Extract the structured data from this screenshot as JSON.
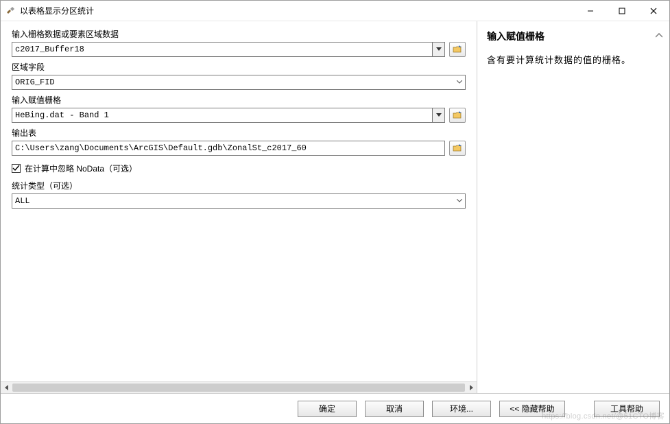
{
  "window": {
    "title": "以表格显示分区统计"
  },
  "form": {
    "input_raster_label": "输入栅格数据或要素区域数据",
    "input_raster_value": "c2017_Buffer18",
    "zone_field_label": "区域字段",
    "zone_field_value": "ORIG_FID",
    "value_raster_label": "输入赋值栅格",
    "value_raster_value": "HeBing.dat - Band 1",
    "output_table_label": "输出表",
    "output_table_value": "C:\\Users\\zang\\Documents\\ArcGIS\\Default.gdb\\ZonalSt_c2017_60",
    "ignore_nodata_checked": true,
    "ignore_nodata_label": "在计算中忽略 NoData（可选）",
    "stat_type_label": "统计类型（可选）",
    "stat_type_value": "ALL"
  },
  "help": {
    "title": "输入赋值栅格",
    "body": "含有要计算统计数据的值的栅格。"
  },
  "footer": {
    "ok": "确定",
    "cancel": "取消",
    "env": "环境...",
    "hide_help": "<< 隐藏帮助",
    "tool_help": "工具帮助"
  },
  "watermark": "https://blog.csdn.net/@51CTO博客"
}
